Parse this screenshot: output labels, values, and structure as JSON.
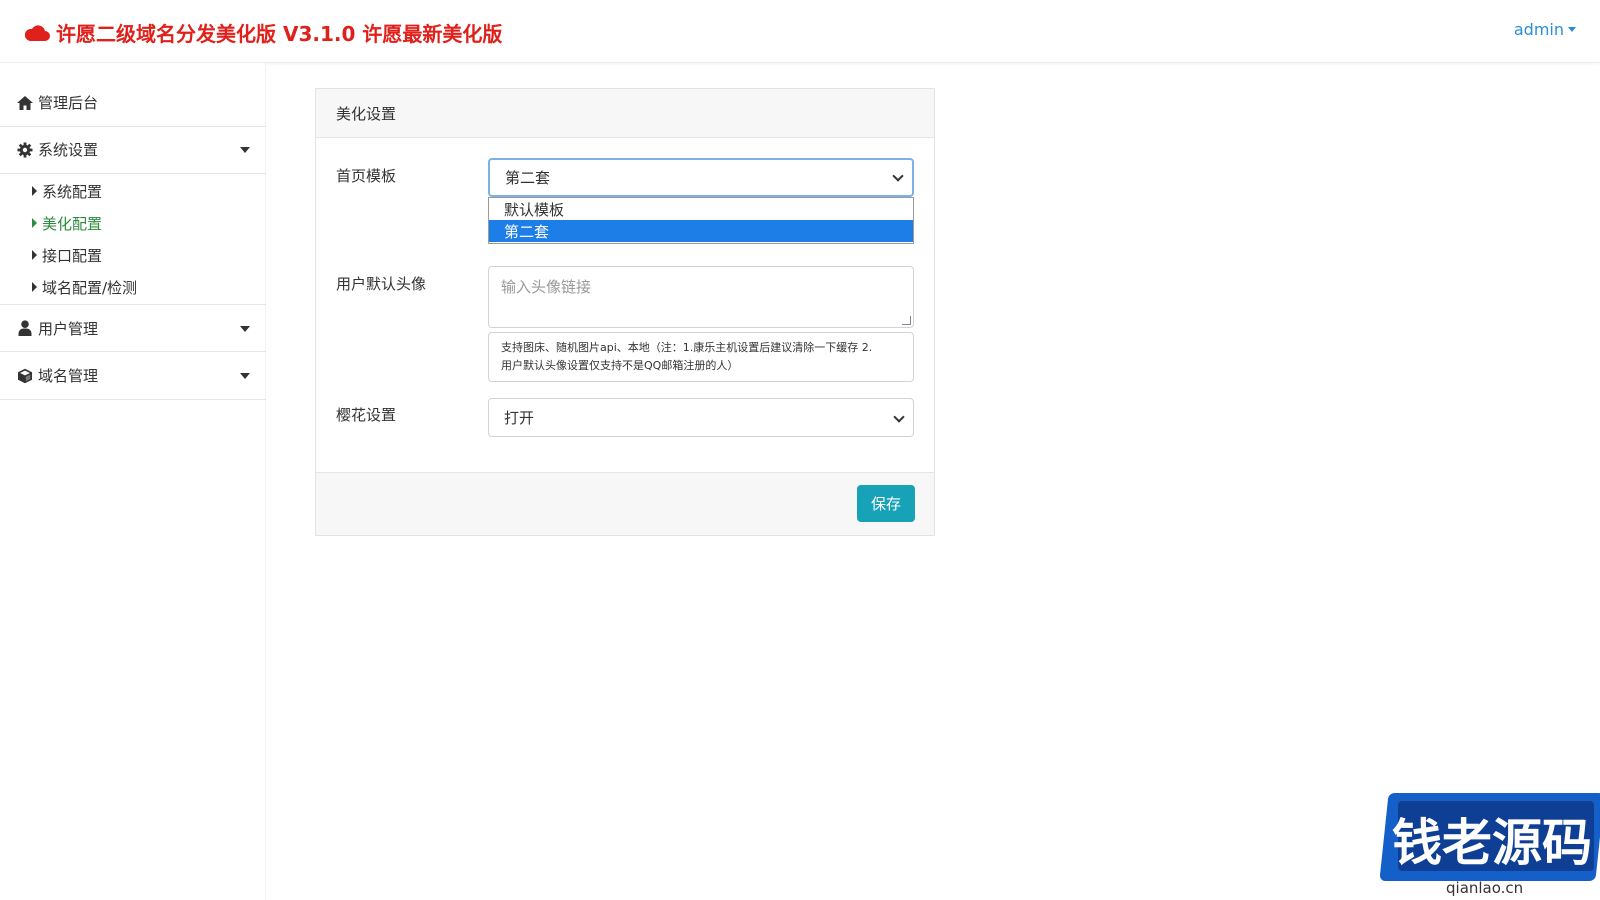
{
  "header": {
    "title": "许愿二级域名分发美化版 V3.1.0 许愿最新美化版",
    "brand_color": "#e0201b",
    "user": "admin"
  },
  "sidebar": {
    "dashboard": "管理后台",
    "system": {
      "label": "系统设置",
      "items": [
        "系统配置",
        "美化配置",
        "接口配置",
        "域名配置/检测"
      ],
      "active": "美化配置"
    },
    "users": "用户管理",
    "domains": "域名管理"
  },
  "form": {
    "card_title": "美化设置",
    "template": {
      "label": "首页模板",
      "value": "第二套",
      "options": [
        "默认模板",
        "第二套"
      ]
    },
    "avatar": {
      "label": "用户默认头像",
      "placeholder": "输入头像链接",
      "help_line1": "支持图床、随机图片api、本地（注：1.康乐主机设置后建议清除一下缓存 2.",
      "help_line2": "用户默认头像设置仅支持不是QQ邮箱注册的人）"
    },
    "sakura": {
      "label": "樱花设置",
      "value": "打开"
    },
    "save": "保存"
  },
  "watermark": {
    "text": "钱老源码",
    "url": "qianlao.cn"
  },
  "colors": {
    "active_nav": "#2e8b3e",
    "primary": "#17a2b8",
    "selected_option": "#1e7ee8"
  }
}
